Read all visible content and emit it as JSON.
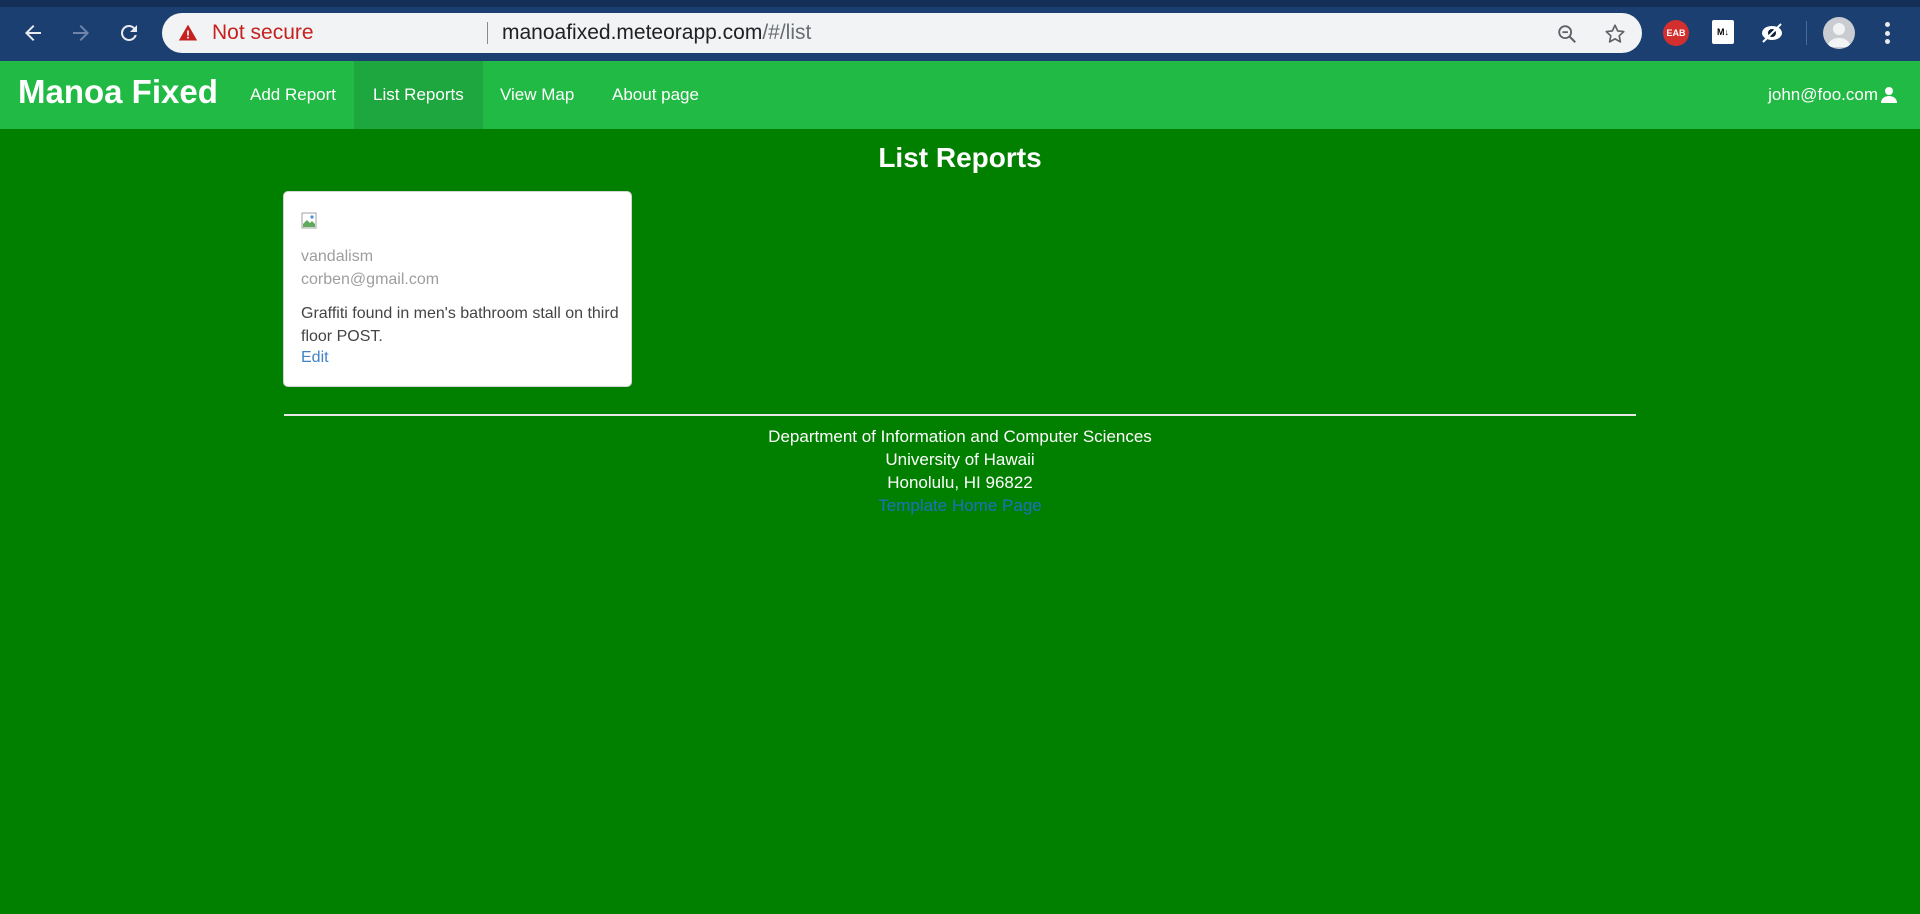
{
  "browser": {
    "not_secure_label": "Not secure",
    "url_host": "manoafixed.meteorapp.com",
    "url_path": "/#/list",
    "extensions": [
      "EAB",
      "M↓"
    ]
  },
  "navbar": {
    "brand": "Manoa Fixed",
    "items": [
      {
        "label": "Add Report",
        "active": false
      },
      {
        "label": "List Reports",
        "active": true
      },
      {
        "label": "View Map",
        "active": false
      },
      {
        "label": "About page",
        "active": false
      }
    ],
    "user": "john@foo.com"
  },
  "main": {
    "title": "List Reports",
    "reports": [
      {
        "category": "vandalism",
        "email": "corben@gmail.com",
        "description": "Graffiti found in men's bathroom stall on third floor POST.",
        "edit_label": "Edit"
      }
    ]
  },
  "footer": {
    "line1": "Department of Information and Computer Sciences",
    "line2": "University of Hawaii",
    "line3": "Honolulu, HI 96822",
    "link": "Template Home Page"
  },
  "colors": {
    "page_bg": "#018000",
    "navbar_bg": "#21ba45",
    "navbar_active": "#1ea73e",
    "link": "#4183c4"
  }
}
